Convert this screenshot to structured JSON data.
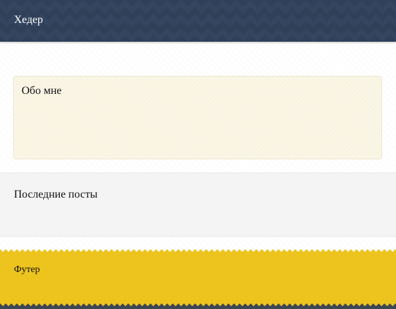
{
  "header": {
    "title": "Хедер"
  },
  "about": {
    "title": "Обо мне"
  },
  "posts": {
    "title": "Последние посты"
  },
  "footer": {
    "title": "Футер"
  },
  "colors": {
    "header_bg": "#34465f",
    "about_bg": "#faf6e6",
    "posts_bg": "#f4f4f4",
    "footer_bg": "#edc31e"
  }
}
